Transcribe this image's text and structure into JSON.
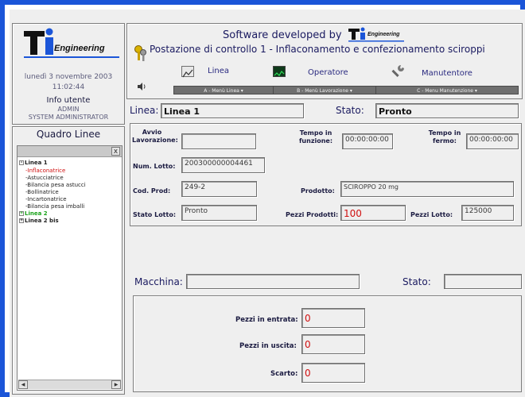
{
  "brand": {
    "logo_text": "Engineering",
    "small_logo_text": "Engineering"
  },
  "left": {
    "date": "lunedì 3 novembre 2003",
    "time": "11:02:44",
    "user_title": "Info utente",
    "user_name": "ADMIN",
    "user_role": "SYSTEM ADMINISTRATOR",
    "section_title": "Quadro Linee"
  },
  "tree": {
    "close": "x",
    "nodes": [
      {
        "label": "Linea 1",
        "sign": "-"
      },
      {
        "label": "Inflaconatrice"
      },
      {
        "label": "Astucciatrice"
      },
      {
        "label": "Bilancia pesa astucci"
      },
      {
        "label": "Bollinatrice"
      },
      {
        "label": "Incartonatrice"
      },
      {
        "label": "Bilancia pesa imballi"
      },
      {
        "label": "Linea 2",
        "sign": "+"
      },
      {
        "label": "Linea 2 bis",
        "sign": "+"
      }
    ]
  },
  "header": {
    "line1": "Software developed by",
    "line2": "Postazione di controllo 1 - Inflaconamento e confezionamento sciroppi",
    "menus": [
      {
        "label": "Linea",
        "tab": "A - Menù Linea",
        "icon": "chart-icon"
      },
      {
        "label": "Operatore",
        "tab": "B - Menù Lavorazione",
        "icon": "monitor-icon"
      },
      {
        "label": "Manutentore",
        "tab": "C - Menu Manutenzione",
        "icon": "wrench-icon"
      }
    ]
  },
  "status_bar": {
    "linea_label": "Linea:",
    "linea_value": "Linea 1",
    "stato_label": "Stato:",
    "stato_value": "Pronto"
  },
  "batch": {
    "avvio_label": "Avvio Lavorazione:",
    "avvio_value": "",
    "tempo_funz_label": "Tempo in funzione:",
    "tempo_funz_value": "00:00:00:00",
    "tempo_fermo_label": "Tempo in fermo:",
    "tempo_fermo_value": "00:00:00:00",
    "num_lotto_label": "Num. Lotto:",
    "num_lotto_value": "200300000004461",
    "cod_prod_label": "Cod. Prod:",
    "cod_prod_value": "249-2",
    "prodotto_label": "Prodotto:",
    "prodotto_value": "SCIROPPO 20 mg",
    "stato_lotto_label": "Stato Lotto:",
    "stato_lotto_value": "Pronto",
    "pezzi_prod_label": "Pezzi Prodotti:",
    "pezzi_prod_value": "100",
    "pezzi_lotto_label": "Pezzi Lotto:",
    "pezzi_lotto_value": "125000"
  },
  "machine": {
    "macchina_label": "Macchina:",
    "macchina_value": "",
    "stato_label": "Stato:",
    "stato_value": ""
  },
  "counters": {
    "entrata_label": "Pezzi in entrata:",
    "entrata_value": "0",
    "uscita_label": "Pezzi in uscita:",
    "uscita_value": "0",
    "scarto_label": "Scarto:",
    "scarto_value": "0"
  }
}
